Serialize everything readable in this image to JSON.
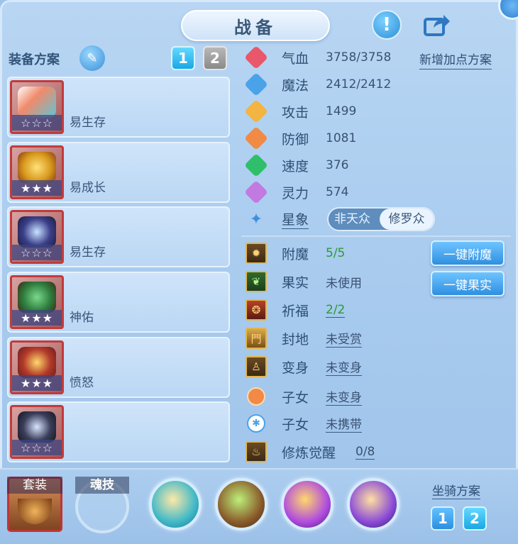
{
  "title": "战备",
  "equipment": {
    "plan_label": "装备方案",
    "plan_tabs": [
      "1",
      "2"
    ],
    "items": [
      {
        "name": "易生存",
        "stars": "☆☆☆",
        "icon": "ice-pop-icon"
      },
      {
        "name": "易成长",
        "stars": "★★★",
        "icon": "golden-helmet-icon"
      },
      {
        "name": "易生存",
        "stars": "☆☆☆",
        "icon": "dark-armor-icon"
      },
      {
        "name": "神佑",
        "stars": "★★★",
        "icon": "jade-necklace-icon"
      },
      {
        "name": "愤怒",
        "stars": "★★★",
        "icon": "gem-belt-icon"
      },
      {
        "name": "",
        "stars": "☆☆☆",
        "icon": "shadow-boots-icon"
      }
    ]
  },
  "stats": {
    "add_plan": "新增加点方案",
    "rows": [
      {
        "name": "气血",
        "value": "3758/3758",
        "color": "#e8576a"
      },
      {
        "name": "魔法",
        "value": "2412/2412",
        "color": "#4aa3e8"
      },
      {
        "name": "攻击",
        "value": "1499",
        "color": "#f2b442"
      },
      {
        "name": "防御",
        "value": "1081",
        "color": "#f08a45"
      },
      {
        "name": "速度",
        "value": "376",
        "color": "#2fbf6a"
      },
      {
        "name": "灵力",
        "value": "574",
        "color": "#c27ae0"
      }
    ],
    "constellation": {
      "name": "星象",
      "options": [
        "非天众",
        "修罗众"
      ],
      "selected": "修罗众"
    }
  },
  "extras": [
    {
      "name": "附魔",
      "value": "5/5"
    },
    {
      "name": "果实",
      "value": "未使用"
    },
    {
      "name": "祈福",
      "value": "2/2"
    },
    {
      "name": "封地",
      "value": "未受赏"
    },
    {
      "name": "变身",
      "value": "未变身"
    },
    {
      "name": "子女",
      "value": "未变身"
    },
    {
      "name": "子女",
      "value": "未携带"
    },
    {
      "name": "修炼觉醒",
      "value": "0/8"
    }
  ],
  "actions": {
    "enchant": "一键附魔",
    "fruit": "一键果实"
  },
  "bottom": {
    "suit_label": "套装",
    "soul_label": "魂技",
    "mount_label": "坐骑方案",
    "mount_tabs": [
      "1",
      "2"
    ]
  }
}
